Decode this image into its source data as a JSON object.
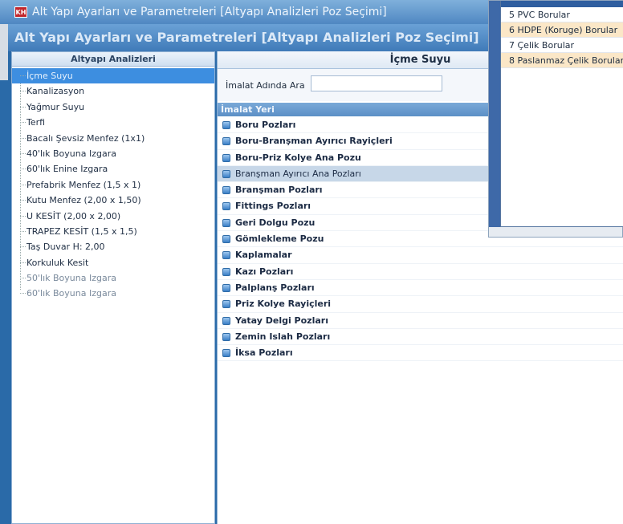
{
  "window": {
    "title": "Alt Yapı Ayarları ve Parametreleri [Altyapı Analizleri Poz Seçimi]",
    "app_icon": "KH"
  },
  "form": {
    "title": "Alt Yapı Ayarları ve Parametreleri [Altyapı Analizleri Poz Seçimi]"
  },
  "left_panel": {
    "header": "Altyapı Analizleri",
    "items": [
      {
        "label": "İçme Suyu",
        "selected": true
      },
      {
        "label": "Kanalizasyon"
      },
      {
        "label": "Yağmur Suyu"
      },
      {
        "label": "Terfi"
      },
      {
        "label": "Bacalı Şevsiz Menfez (1x1)"
      },
      {
        "label": "40'lık Boyuna Izgara"
      },
      {
        "label": "60'lık Enine Izgara"
      },
      {
        "label": "Prefabrik Menfez (1,5 x 1)"
      },
      {
        "label": "Kutu Menfez (2,00 x 1,50)"
      },
      {
        "label": "U KESİT (2,00 x 2,00)"
      },
      {
        "label": "TRAPEZ KESİT (1,5 x 1,5)"
      },
      {
        "label": "Taş Duvar H: 2,00"
      },
      {
        "label": "Korkuluk Kesit"
      },
      {
        "label": "50'lık Boyuna Izgara",
        "dim": true
      },
      {
        "label": "60'lık Boyuna Izgara",
        "dim": true
      }
    ]
  },
  "right_panel": {
    "title": "İçme Suyu",
    "search": {
      "label": "İmalat Adında Ara",
      "value": ""
    },
    "column_header": "İmalat Yeri",
    "items": [
      {
        "label": "Boru Pozları"
      },
      {
        "label": "Boru-Branşman Ayırıcı Rayiçleri"
      },
      {
        "label": "Boru-Priz Kolye Ana Pozu"
      },
      {
        "label": "Branşman Ayırıcı Ana Pozları",
        "selected": true
      },
      {
        "label": "Branşman Pozları"
      },
      {
        "label": "Fittings Pozları"
      },
      {
        "label": "Geri Dolgu Pozu"
      },
      {
        "label": "Gömlekleme Pozu"
      },
      {
        "label": "Kaplamalar"
      },
      {
        "label": "Kazı Pozları"
      },
      {
        "label": "Palplanş Pozları"
      },
      {
        "label": "Priz Kolye Rayiçleri"
      },
      {
        "label": "Yatay Delgi Pozları"
      },
      {
        "label": "Zemin Islah Pozları"
      },
      {
        "label": "İksa Pozları"
      }
    ]
  },
  "popup_list": {
    "items": [
      {
        "label": "5 PVC Borular"
      },
      {
        "label": "6 HDPE (Koruge) Borular",
        "highlight": true
      },
      {
        "label": "7 Çelik Borular"
      },
      {
        "label": "8 Paslanmaz Çelik Borular",
        "highlight": true
      }
    ]
  },
  "colors": {
    "selection": "#3d8ee0",
    "header_blue": "#4f87c2",
    "highlight": "#fbe7c7"
  }
}
